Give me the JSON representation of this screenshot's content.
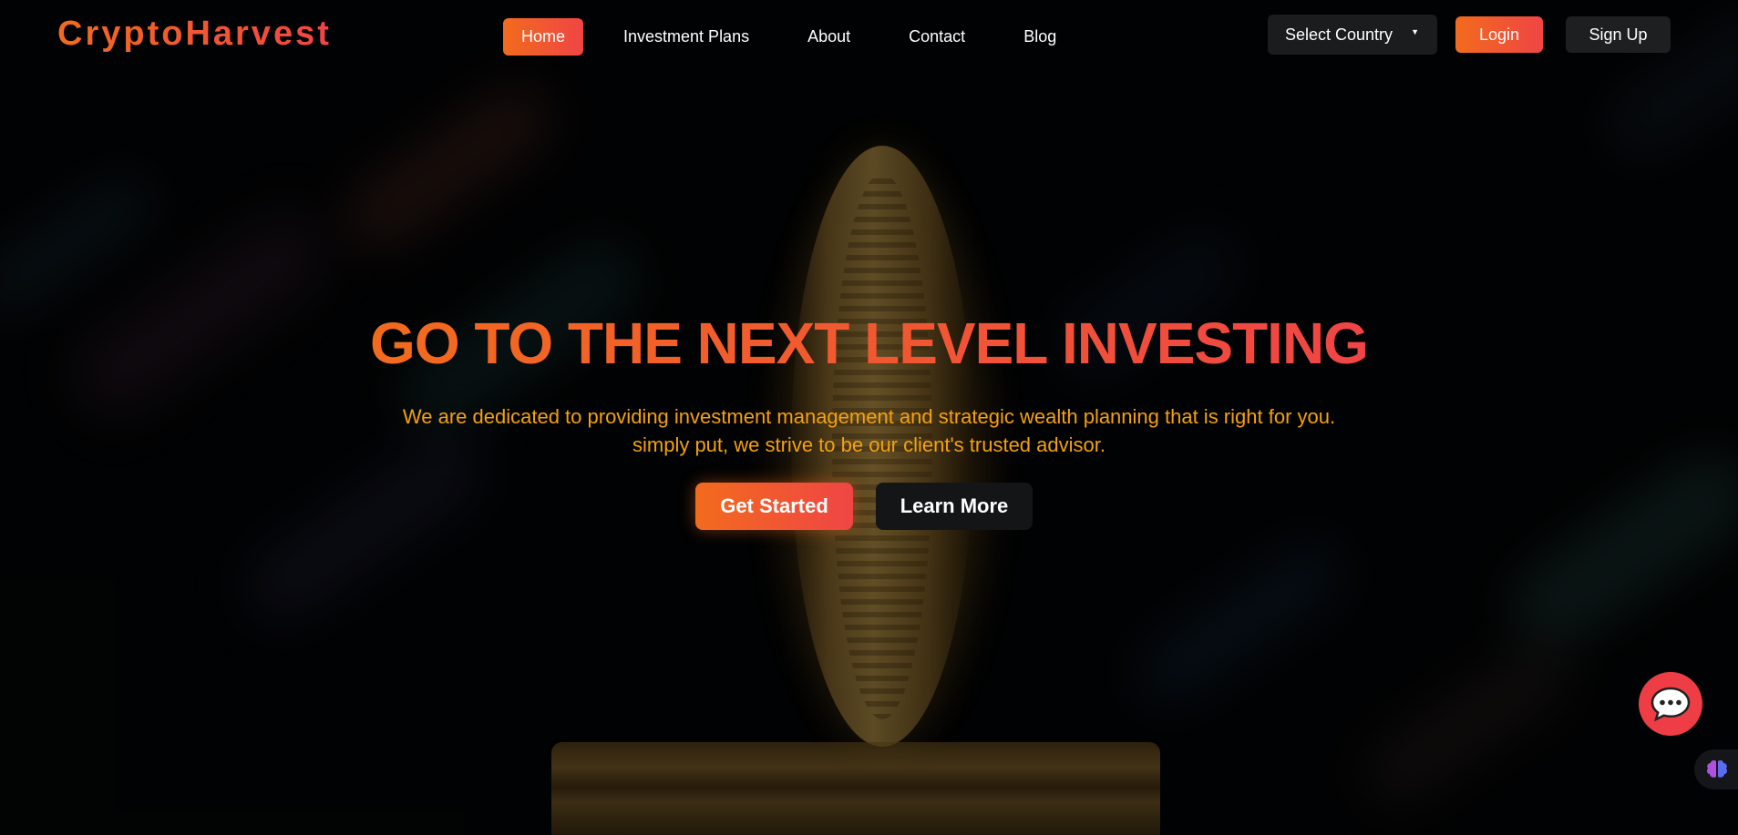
{
  "brand": {
    "name": "CryptoHarvest",
    "colors": {
      "accent_start": "#f26b1d",
      "accent_end": "#f04545",
      "subtitle": "#f5a10c",
      "dark_button": "#1e1f21",
      "chat_bubble": "#ee3d45"
    }
  },
  "nav": {
    "items": [
      {
        "label": "Home",
        "active": true
      },
      {
        "label": "Investment Plans",
        "active": false
      },
      {
        "label": "About",
        "active": false
      },
      {
        "label": "Contact",
        "active": false
      },
      {
        "label": "Blog",
        "active": false
      }
    ]
  },
  "header_actions": {
    "country_select": {
      "value": "Select Country",
      "icon": "caret-down-icon"
    },
    "login_label": "Login",
    "signup_label": "Sign Up"
  },
  "hero": {
    "title": "GO TO THE NEXT LEVEL INVESTING",
    "subtitle": "We are dedicated to providing investment management and strategic wealth planning that is right for you. simply put, we strive to be our client's trusted advisor.",
    "primary_cta": "Get Started",
    "secondary_cta": "Learn More",
    "background_icon": "bitcoin-coin-image"
  },
  "widgets": {
    "chat_icon": "chat-bubble-icon",
    "side_icon": "brain-icon"
  }
}
